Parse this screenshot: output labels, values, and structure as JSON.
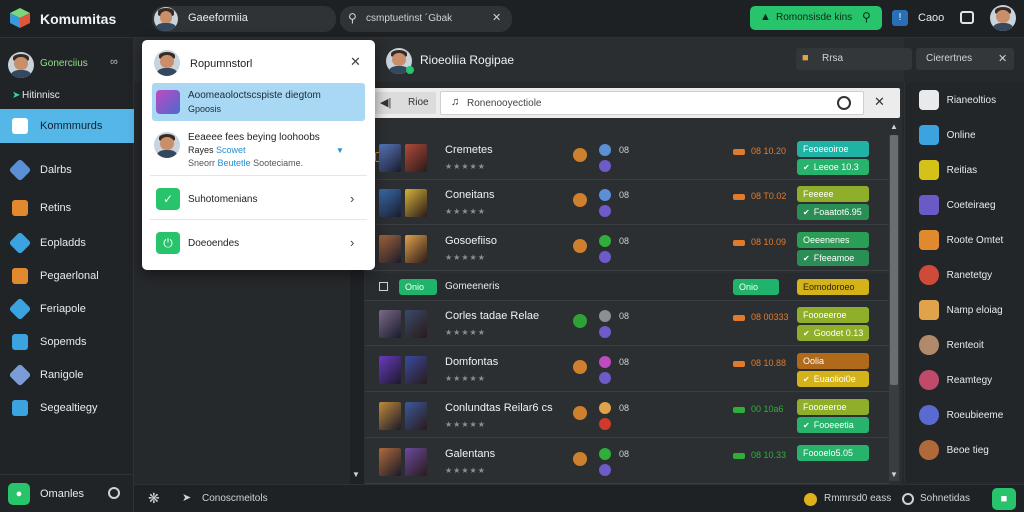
{
  "app": {
    "title": "Komumitas"
  },
  "topbar": {
    "profile_name": "Gaeeformiia",
    "search_text": "csmptuetinst ´Gbak",
    "action_label": "Romonsisde kins",
    "user_label": "Caoo"
  },
  "sidebar": {
    "user": {
      "name": "Gonerciius"
    },
    "section_label": "Hitinnisc",
    "items": [
      {
        "label": "Kommmurds",
        "icon": "community-icon",
        "color": "#0c6fb0",
        "active": true
      },
      {
        "label": "Dalrbs",
        "icon": "cube-icon",
        "color": "#5b8fd6"
      },
      {
        "label": "Retins",
        "icon": "wrench-icon",
        "color": "#e0892e"
      },
      {
        "label": "Eopladds",
        "icon": "bolt-icon",
        "color": "#3aa3e0"
      },
      {
        "label": "Pegaerlonal",
        "icon": "puzzle-icon",
        "color": "#e0892e"
      },
      {
        "label": "Feriapole",
        "icon": "arrow-icon",
        "color": "#3aa3e0"
      },
      {
        "label": "Sopemds",
        "icon": "face-icon",
        "color": "#3aa3e0"
      },
      {
        "label": "Ranigole",
        "icon": "tools-icon",
        "color": "#7c9cd8"
      },
      {
        "label": "Segealtiegy",
        "icon": "lightning-icon",
        "color": "#3aa3e0"
      }
    ],
    "footer_label": "Omanles"
  },
  "dropdown": {
    "header_name": "Ropumnstorl",
    "highlighted": {
      "title": "Aoomeaoloctscspiste diegtom",
      "subtitle": "Gpoosis"
    },
    "post": {
      "title": "Eeaeee fees beying loohoobs",
      "line2_a": "Rayes",
      "line2_b": "Scowet",
      "line3_a": "Sneorr",
      "line3_b": "Beutetle",
      "line3_c": "Sooteciame."
    },
    "options": [
      {
        "label": "Suhotomenians"
      },
      {
        "label": "Doeoendes"
      }
    ]
  },
  "main": {
    "header_title": "Rioeoliia Rogipae",
    "lock_label": "Rrsa",
    "header_button": "Cierertnes",
    "toolbar": {
      "back_label": "Rioe",
      "filter_text": "Ronenooyectiole"
    },
    "rows": [
      {
        "title": "Cremetes",
        "thumb_a": "#5a7ac0",
        "thumb_b": "#b04a3a",
        "lead_icon": "flame-icon",
        "lead_color": "#e08a2e",
        "stat_a": "08",
        "stat_b": "",
        "price": "08 10.20",
        "price_color": "#e07b2e",
        "tag_top": "Feoeeoiroe",
        "tag_top_bg": "#1fb3a6",
        "tag_bot": "Leeoe 10.3",
        "tag_bot_bg": "#27b36b",
        "dot_a": "#5b8fd6",
        "dot_b": "#6e5ac8"
      },
      {
        "title": "Coneitans",
        "thumb_a": "#3a6fb0",
        "thumb_b": "#d4b23a",
        "lead_icon": "square-icon",
        "lead_color": "#e08a2e",
        "stat_a": "08",
        "stat_b": "",
        "price": "08 T0.02",
        "price_color": "#e07b2e",
        "tag_top": "Feeeee",
        "tag_top_bg": "#8fae2a",
        "tag_bot": "Foaatot6.95",
        "tag_bot_bg": "#2a8f55",
        "dot_a": "#5b8fd6",
        "dot_b": "#6e5ac8"
      },
      {
        "title": "Gosoefiiso",
        "thumb_a": "#a5683a",
        "thumb_b": "#e0a24a",
        "lead_icon": "square-icon",
        "lead_color": "#e08a2e",
        "stat_a": "08",
        "stat_b": "",
        "price": "08 10.09",
        "price_color": "#e07b2e",
        "tag_top": "Oeeenenes",
        "tag_top_bg": "#2a9e55",
        "tag_bot": "Ffeeamoe",
        "tag_bot_bg": "#2a8f55",
        "dot_a": "#2fae3a",
        "dot_b": "#6e5ac8"
      },
      {
        "title": "Gomeeneris",
        "group": true,
        "chip": "Onio",
        "chip_bg": "#1fb36b",
        "status": "Onio",
        "status_bg": "#1fb36b",
        "tag": "Eomodoroeo",
        "tag_bg": "#d4b21a"
      },
      {
        "title": "Corles tadae Relae",
        "thumb_a": "#7a6a8a",
        "thumb_b": "#3a4a6a",
        "lead_icon": "check-icon",
        "lead_color": "#2fae3a",
        "stat_a": "08",
        "stat_b": "",
        "price": "08 00333",
        "price_color": "#e07b2e",
        "tag_top": "Foooeeroe",
        "tag_top_bg": "#8fae2a",
        "tag_bot": "Goodet 0.13",
        "tag_bot_bg": "#8fae2a",
        "dot_a": "#8a8f94",
        "dot_b": "#6e5ac8"
      },
      {
        "title": "Domfontas",
        "thumb_a": "#6a3ac0",
        "thumb_b": "#3a4aa0",
        "lead_icon": "square-icon",
        "lead_color": "#e08a2e",
        "stat_a": "08",
        "stat_b": "",
        "price": "08 10.88",
        "price_color": "#e07b2e",
        "tag_top": "Oolia",
        "tag_top_bg": "#b06a1a",
        "tag_bot": "Euaolioi0e",
        "tag_bot_bg": "#d4b21a",
        "dot_a": "#c04ac0",
        "dot_b": "#6e5ac8"
      },
      {
        "title": "Conlundtas Reilar6 cs",
        "thumb_a": "#c08a3a",
        "thumb_b": "#3a5a9a",
        "lead_icon": "none",
        "lead_color": "#e08a2e",
        "stat_a": "08",
        "stat_b": "",
        "price": "00 10a6",
        "price_color": "#2fae3a",
        "tag_top": "Foooeeroe",
        "tag_top_bg": "#8fae2a",
        "tag_bot": "Fooeeetia",
        "tag_bot_bg": "#27b36b",
        "dot_a": "#e0a24a",
        "dot_b": "#d03a2a"
      },
      {
        "title": "Galentans",
        "thumb_a": "#b06a3a",
        "thumb_b": "#6a4aa0",
        "lead_icon": "square-icon",
        "lead_color": "#e08a2e",
        "stat_a": "08",
        "stat_b": "",
        "price": "08 10.33",
        "price_color": "#2fae3a",
        "tag_top": "Foooelo5.05",
        "tag_top_bg": "#27b36b",
        "tag_bot": "",
        "tag_bot_bg": "",
        "dot_a": "#2fae3a",
        "dot_b": "#6e5ac8"
      }
    ]
  },
  "rightbar": {
    "items": [
      {
        "label": "Rianeoltios",
        "color": "#e8eaec",
        "icon": "arrow-left-icon"
      },
      {
        "label": "Online",
        "color": "#3aa3e0",
        "icon": "chat-icon"
      },
      {
        "label": "Reitias",
        "color": "#d4c21a",
        "icon": "cube-icon"
      },
      {
        "label": "Coeteiraeg",
        "color": "#6a5ac8",
        "icon": "controller-icon"
      },
      {
        "label": "Roote Omtet",
        "color": "#e0892e",
        "icon": "box-icon"
      },
      {
        "label": "Ranetetgy",
        "color": "#d04a3a",
        "icon": "avatar-icon"
      },
      {
        "label": "Namp eloiag",
        "color": "#e0a24a",
        "icon": "burger-icon"
      },
      {
        "label": "Renteoit",
        "color": "#b08a6a",
        "icon": "avatar-icon"
      },
      {
        "label": "Reamtegy",
        "color": "#c04a6a",
        "icon": "avatar-icon"
      },
      {
        "label": "Roeubieeme",
        "color": "#5a6ad0",
        "icon": "avatar-icon"
      },
      {
        "label": "Beoe tieg",
        "color": "#b06a3a",
        "icon": "avatar-icon"
      }
    ]
  },
  "bottombar": {
    "text": "Conoscmeitols",
    "coins_label": "Rmmrsd0 eass",
    "status_label": "Sohnetidas"
  }
}
